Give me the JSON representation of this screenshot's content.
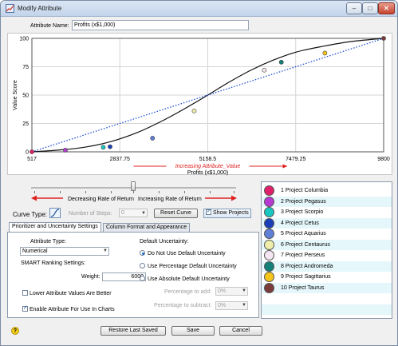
{
  "window": {
    "title": "Modify Attribute",
    "buttons": {
      "minimize": "–",
      "maximize": "□",
      "close": "✕"
    }
  },
  "attribute_name": {
    "label": "Attribute Name:",
    "value": "Profits (x$1,000)"
  },
  "chart_data": {
    "type": "line",
    "ylabel": "Value Score",
    "xlabel": "Profits (x$1,000)",
    "axis_caption": "Increasing Attribute_Value",
    "x_tick_labels": [
      "517",
      "2837.75",
      "5158.5",
      "7479.25",
      "9800"
    ],
    "y_tick_labels": [
      "0",
      "25",
      "50",
      "75",
      "100"
    ],
    "xlim": [
      517,
      9800
    ],
    "ylim": [
      0,
      100
    ],
    "grid": true,
    "series": [
      {
        "style": "solid",
        "color": "#111111",
        "x": [
          517,
          1200,
          1900,
          2600,
          3300,
          4000,
          4600,
          5158.5,
          5700,
          6300,
          6900,
          7500,
          8200,
          8900,
          9800
        ],
        "y": [
          0,
          1.5,
          4,
          9,
          17,
          28,
          39,
          50,
          61,
          72,
          81,
          88,
          93,
          97,
          100
        ]
      },
      {
        "style": "dotted",
        "color": "#1f4fd8",
        "x": [
          517,
          9800
        ],
        "y": [
          0,
          100
        ]
      }
    ],
    "points": [
      {
        "project": "Project Columbia",
        "x": 517,
        "y": 0,
        "color": "#e0206a"
      },
      {
        "project": "Project Pegasus",
        "x": 1400,
        "y": 1.5,
        "color": "#b63ad1"
      },
      {
        "project": "Project Scorpio",
        "x": 2400,
        "y": 4,
        "color": "#1ac6c0"
      },
      {
        "project": "Project Cetus",
        "x": 2580,
        "y": 4.5,
        "color": "#1a3fb8"
      },
      {
        "project": "Project Aquarius",
        "x": 3700,
        "y": 12,
        "color": "#5f7fd6"
      },
      {
        "project": "Project Centaurus",
        "x": 4800,
        "y": 36,
        "color": "#eeeeaa"
      },
      {
        "project": "Project Perseus",
        "x": 6650,
        "y": 72,
        "color": "#f3e6f0"
      },
      {
        "project": "Project Andromeda",
        "x": 7100,
        "y": 79,
        "color": "#13807a"
      },
      {
        "project": "Project Sagittarius",
        "x": 8250,
        "y": 87,
        "color": "#f4c51a"
      },
      {
        "project": "Project Taurus",
        "x": 9800,
        "y": 100,
        "color": "#7a3b3b"
      }
    ]
  },
  "rate": {
    "decreasing": "Decreasing Rate of Return",
    "increasing": "Increasing Rate of Return"
  },
  "curve": {
    "type_label": "Curve Type:",
    "steps_label": "Number of Steps:",
    "steps_value": "0",
    "reset_label": "Reset Curve",
    "show_projects_label": "Show Projects"
  },
  "tabs": [
    {
      "label": "Prioritizer and Uncertainty Settings",
      "active": true
    },
    {
      "label": "Column Format and Appearance",
      "active": false
    }
  ],
  "prioritizer": {
    "attribute_type_label": "Attribute Type:",
    "attribute_type_value": "Numerical",
    "smart_label": "SMART Ranking Settings:",
    "weight_label": "Weight:",
    "weight_value": "6000",
    "lower_better_label": "Lower Attribute Values Are Better",
    "enable_charts_label": "Enable Attribute For Use In Charts",
    "default_uncertainty_label": "Default Uncertainty:",
    "radio_none": "Do Not Use Default Uncertainty",
    "radio_percent": "Use Percentage Default Uncertainty",
    "radio_absolute": "Use Absolute Default Uncertainty",
    "pct_add_label": "Percentage to add:",
    "pct_add_value": "0%",
    "pct_sub_label": "Percentage to subtract:",
    "pct_sub_value": "0%"
  },
  "legend": {
    "items": [
      {
        "index": "1",
        "name": "Project Columbia",
        "color": "#e0206a"
      },
      {
        "index": "2",
        "name": "Project Pegasus",
        "color": "#b63ad1"
      },
      {
        "index": "3",
        "name": "Project Scorpio",
        "color": "#1ac6c0"
      },
      {
        "index": "4",
        "name": "Project Cetus",
        "color": "#1a3fb8"
      },
      {
        "index": "5",
        "name": "Project Aquarius",
        "color": "#5f7fd6"
      },
      {
        "index": "6",
        "name": "Project Centaurus",
        "color": "#eeeeaa"
      },
      {
        "index": "7",
        "name": "Project Perseus",
        "color": "#f3e6f0"
      },
      {
        "index": "8",
        "name": "Project Andromeda",
        "color": "#13807a"
      },
      {
        "index": "9",
        "name": "Project Sagittarius",
        "color": "#f4c51a"
      },
      {
        "index": "10",
        "name": "Project Taurus",
        "color": "#7a3b3b"
      }
    ]
  },
  "footer": {
    "restore_label": "Restore Last Saved",
    "save_label": "Save",
    "cancel_label": "Cancel",
    "help_glyph": "?"
  }
}
